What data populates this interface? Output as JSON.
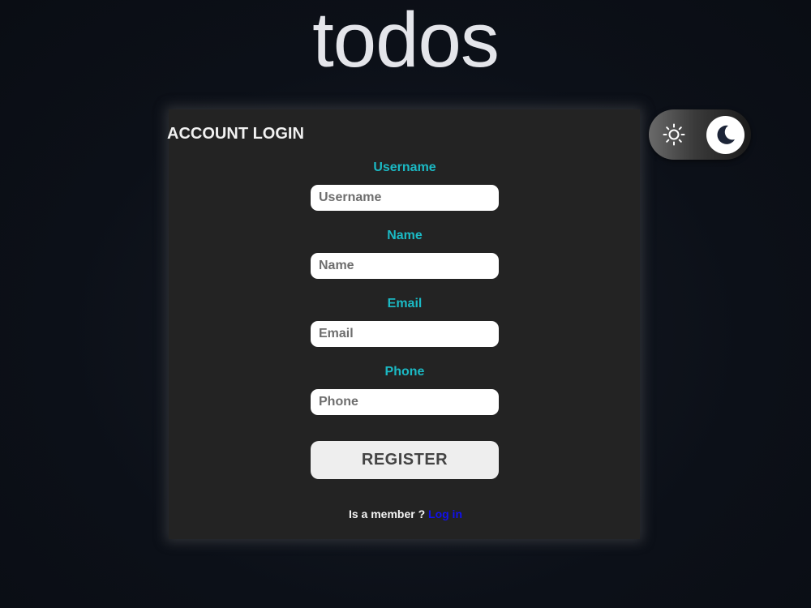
{
  "header": {
    "app_title": "todos"
  },
  "form": {
    "title": "ACCOUNT LOGIN",
    "fields": [
      {
        "label": "Username",
        "placeholder": "Username",
        "value": ""
      },
      {
        "label": "Name",
        "placeholder": "Name",
        "value": ""
      },
      {
        "label": "Email",
        "placeholder": "Email",
        "value": ""
      },
      {
        "label": "Phone",
        "placeholder": "Phone",
        "value": ""
      }
    ],
    "submit_label": "REGISTER",
    "footer_text": "Is a member ? ",
    "login_link": "Log in"
  },
  "theme_toggle": {
    "light_icon": "sun-icon",
    "dark_icon": "moon-icon",
    "active": "dark"
  },
  "colors": {
    "background": "#0c1018",
    "card": "#232323",
    "label_accent": "#1bb9c4",
    "link": "#1111ee",
    "title": "#e4e5ea"
  }
}
